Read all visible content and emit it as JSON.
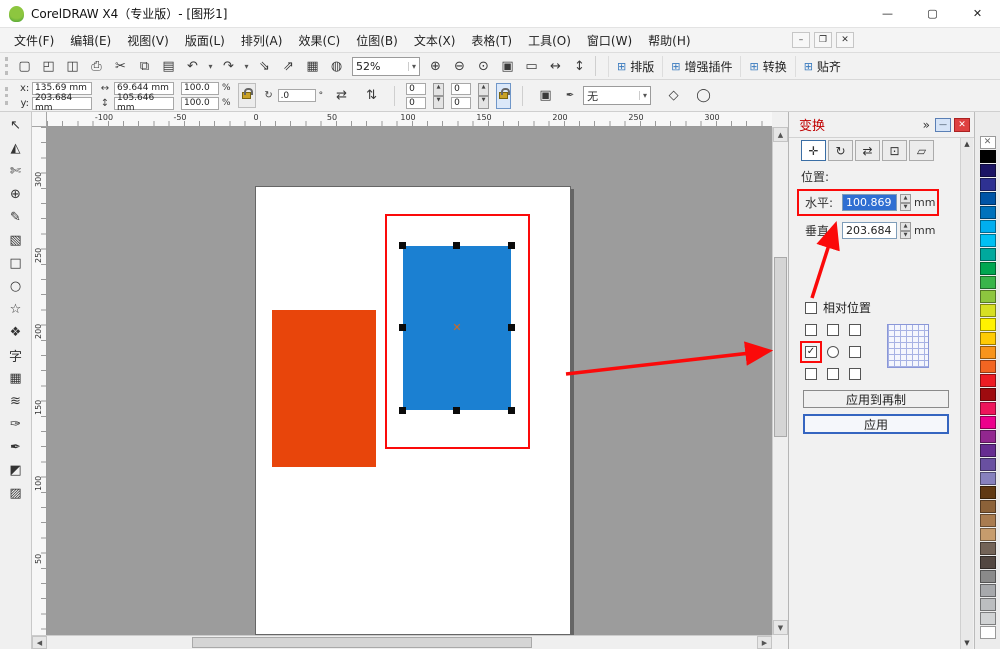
{
  "colors": {
    "annotation_red": "#fb0a0a",
    "canvas_bg": "#9c9c9c",
    "docker_title_red": "#c00000",
    "selection_blue": "#2f6fd2",
    "apply_border": "#3565c0"
  },
  "icons": {
    "minimize": "—",
    "maximize": "▢",
    "close": "✕",
    "dropdown": "▾",
    "chevron_right_double": "»",
    "spin_up": "▲",
    "spin_down": "▼",
    "scroll_up": "▲",
    "scroll_down": "▼",
    "scroll_left": "◀",
    "scroll_right": "▶",
    "check": "✓",
    "center_marker": "✕",
    "width_icon": "↔",
    "height_icon": "↕",
    "rotate_icon": "↻",
    "mirror_h": "⇄",
    "mirror_v": "⇅",
    "pen_icon": "✒",
    "wrap_icon": "▣",
    "curves_icon": "◇",
    "options_icon": "◯"
  },
  "titlebar": {
    "title": "CorelDRAW X4（专业版）- [图形1]"
  },
  "menubar": {
    "items": [
      {
        "label": "文件(F)"
      },
      {
        "label": "编辑(E)"
      },
      {
        "label": "视图(V)"
      },
      {
        "label": "版面(L)"
      },
      {
        "label": "排列(A)"
      },
      {
        "label": "效果(C)"
      },
      {
        "label": "位图(B)"
      },
      {
        "label": "文本(X)"
      },
      {
        "label": "表格(T)"
      },
      {
        "label": "工具(O)"
      },
      {
        "label": "窗口(W)"
      },
      {
        "label": "帮助(H)"
      }
    ],
    "doc_buttons": [
      {
        "name": "document-minimize-button",
        "label": "–"
      },
      {
        "name": "document-restore-button",
        "label": "❐"
      },
      {
        "name": "document-close-button",
        "label": "✕"
      }
    ]
  },
  "toolbar": {
    "zoom_value": "52%",
    "buttons": [
      {
        "name": "new-document-button",
        "label": "▢"
      },
      {
        "name": "open-button",
        "label": "◰"
      },
      {
        "name": "save-button",
        "label": "◫"
      },
      {
        "name": "print-button",
        "label": "⎙"
      },
      {
        "name": "cut-button",
        "label": "✂"
      },
      {
        "name": "copy-button",
        "label": "⧉"
      },
      {
        "name": "paste-button",
        "label": "▤"
      },
      {
        "name": "undo-button",
        "label": "↶"
      },
      {
        "name": "undo-dropdown",
        "label": "▾",
        "cls": "narrow"
      },
      {
        "name": "redo-button",
        "label": "↷"
      },
      {
        "name": "redo-dropdown",
        "label": "▾",
        "cls": "narrow"
      },
      {
        "name": "import-button",
        "label": "⇘"
      },
      {
        "name": "export-button",
        "label": "⇗"
      },
      {
        "name": "application-launcher-button",
        "label": "▦"
      },
      {
        "name": "welcome-screen-button",
        "label": "◍"
      }
    ],
    "zoom_buttons": [
      {
        "name": "zoom-in-button",
        "label": "⊕"
      },
      {
        "name": "zoom-out-button",
        "label": "⊖"
      },
      {
        "name": "zoom-selected-button",
        "label": "⊙"
      },
      {
        "name": "zoom-all-objects-button",
        "label": "▣"
      },
      {
        "name": "zoom-page-button",
        "label": "▭"
      },
      {
        "name": "zoom-page-width-button",
        "label": "↔"
      },
      {
        "name": "zoom-page-height-button",
        "label": "↕"
      }
    ],
    "plugins": [
      {
        "name": "typesetting-button",
        "icon": "⊞",
        "label": "排版"
      },
      {
        "name": "enhanced-plugins-button",
        "icon": "⊞",
        "label": "增强插件"
      },
      {
        "name": "convert-button",
        "icon": "⊞",
        "label": "转换"
      },
      {
        "name": "snap-to-button",
        "icon": "⊞",
        "label": "贴齐"
      }
    ]
  },
  "propbar": {
    "x_label": "x:",
    "x_value": "135.69 mm",
    "y_label": "y:",
    "y_value": "203.684 mm",
    "width_value": "69.644 mm",
    "height_value": "105.646 mm",
    "scale_x_value": "100.0",
    "scale_y_value": "100.0",
    "percent": "%",
    "rotation_value": ".0",
    "degree": "°",
    "corner_tl": "0",
    "corner_tr": "0",
    "corner_bl": "0",
    "corner_br": "0",
    "outline_value": "无"
  },
  "rulers": {
    "h_labels": [
      "-100",
      "-50",
      "0",
      "50",
      "100",
      "150",
      "200",
      "250",
      "300"
    ],
    "v_labels": [
      "300",
      "250",
      "200",
      "150",
      "100",
      "50"
    ]
  },
  "toolbox": {
    "tools": [
      {
        "name": "pick-tool",
        "label": "↖"
      },
      {
        "name": "shape-tool",
        "label": "◭"
      },
      {
        "name": "crop-tool",
        "label": "✄"
      },
      {
        "name": "zoom-tool",
        "label": "⊕"
      },
      {
        "name": "freehand-tool",
        "label": "✎"
      },
      {
        "name": "smart-fill-tool",
        "label": "▧"
      },
      {
        "name": "rectangle-tool",
        "label": "□"
      },
      {
        "name": "ellipse-tool",
        "label": "○"
      },
      {
        "name": "polygon-tool",
        "label": "☆"
      },
      {
        "name": "basic-shapes-tool",
        "label": "❖"
      },
      {
        "name": "text-tool",
        "label": "字"
      },
      {
        "name": "table-tool",
        "label": "▦"
      },
      {
        "name": "interactive-blend-tool",
        "label": "≋"
      },
      {
        "name": "eyedropper-tool",
        "label": "✑"
      },
      {
        "name": "outline-pen-tool",
        "label": "✒"
      },
      {
        "name": "fill-tool",
        "label": "◩"
      },
      {
        "name": "interactive-fill-tool",
        "label": "▨"
      }
    ]
  },
  "canvas": {
    "shapes": {
      "orange_fill": "#e8450b",
      "blue_fill": "#1b80d2"
    }
  },
  "docker": {
    "title": "变换",
    "tabs": [
      {
        "name": "transform-position-button",
        "label": "✛"
      },
      {
        "name": "transform-rotate-button",
        "label": "↻"
      },
      {
        "name": "transform-scale-mirror-button",
        "label": "⇄"
      },
      {
        "name": "transform-size-button",
        "label": "⊡"
      },
      {
        "name": "transform-skew-button",
        "label": "▱"
      }
    ],
    "position_label": "位置:",
    "horizontal_label": "水平:",
    "horizontal_value": "100.869",
    "horizontal_unit": "mm",
    "vertical_label": "垂直:",
    "vertical_value": "203.684",
    "vertical_unit": "mm",
    "relative_position_label": "相对位置",
    "apply_to_duplicate_label": "应用到再制",
    "apply_label": "应用"
  },
  "palette": {
    "swatches": [
      {
        "name": "no-color-swatch",
        "label": "✕"
      },
      {
        "bg": "#000000"
      },
      {
        "bg": "#1b1464"
      },
      {
        "bg": "#2e3192"
      },
      {
        "bg": "#0054a6"
      },
      {
        "bg": "#0072bc"
      },
      {
        "bg": "#00aeef"
      },
      {
        "bg": "#00c0f3"
      },
      {
        "bg": "#00a99d"
      },
      {
        "bg": "#00a651"
      },
      {
        "bg": "#39b54a"
      },
      {
        "bg": "#8dc63f"
      },
      {
        "bg": "#d7df23"
      },
      {
        "bg": "#fff200"
      },
      {
        "bg": "#ffcb05"
      },
      {
        "bg": "#f7941d"
      },
      {
        "bg": "#f26522"
      },
      {
        "bg": "#ed1c24"
      },
      {
        "bg": "#9e0b0f"
      },
      {
        "bg": "#ed145b"
      },
      {
        "bg": "#ec008c"
      },
      {
        "bg": "#92278f"
      },
      {
        "bg": "#662d91"
      },
      {
        "bg": "#6950a1"
      },
      {
        "bg": "#8781bd"
      },
      {
        "bg": "#603913"
      },
      {
        "bg": "#8c6239"
      },
      {
        "bg": "#a97c50"
      },
      {
        "bg": "#c69c6d"
      },
      {
        "bg": "#736357"
      },
      {
        "bg": "#534741"
      },
      {
        "bg": "#8a8a8a"
      },
      {
        "bg": "#a7a9ac"
      },
      {
        "bg": "#bcbec0"
      },
      {
        "bg": "#d1d3d4"
      },
      {
        "bg": "#ffffff"
      }
    ]
  }
}
